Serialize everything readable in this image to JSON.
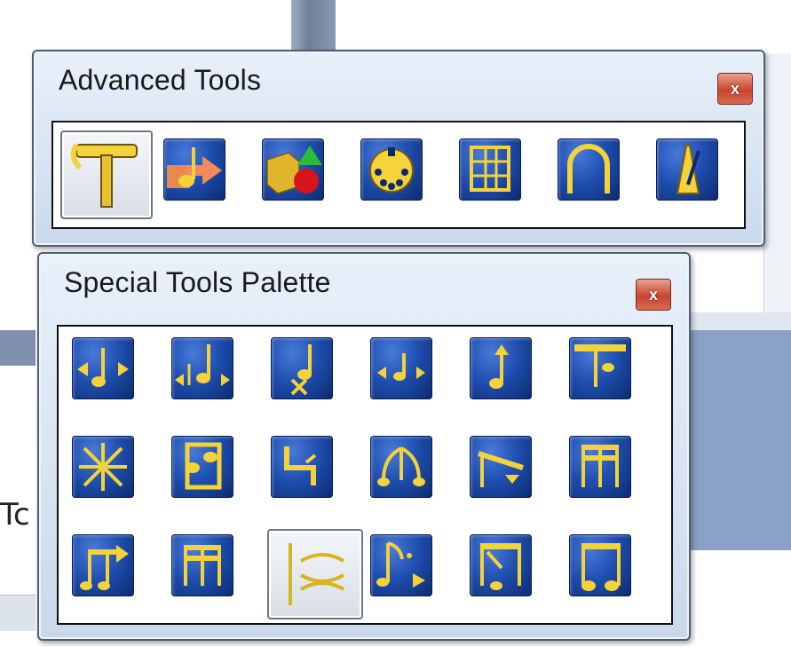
{
  "advanced_tools": {
    "title": "Advanced Tools",
    "close_label": "x",
    "tools": [
      {
        "icon": "hammer-icon",
        "selected": true
      },
      {
        "icon": "note-arrow-icon",
        "selected": false
      },
      {
        "icon": "shapes-icon",
        "selected": false
      },
      {
        "icon": "midi-plug-icon",
        "selected": false
      },
      {
        "icon": "grid-icon",
        "selected": false
      },
      {
        "icon": "arch-icon",
        "selected": false
      },
      {
        "icon": "metronome-icon",
        "selected": false
      }
    ]
  },
  "special_tools": {
    "title": "Special Tools Palette",
    "close_label": "x",
    "tools": [
      {
        "icon": "note-position-icon",
        "selected": false
      },
      {
        "icon": "accidental-mover-icon",
        "selected": false
      },
      {
        "icon": "dot-mover-icon",
        "selected": false
      },
      {
        "icon": "notehead-position-icon",
        "selected": false
      },
      {
        "icon": "stem-length-icon",
        "selected": false
      },
      {
        "icon": "stem-direction-icon",
        "selected": false
      },
      {
        "icon": "custom-stem-icon",
        "selected": false
      },
      {
        "icon": "broken-beam-icon",
        "selected": false
      },
      {
        "icon": "flag-icon",
        "selected": false
      },
      {
        "icon": "beam-angle-icon",
        "selected": false
      },
      {
        "icon": "beam-extension-icon",
        "selected": false
      },
      {
        "icon": "secondary-beam-icon",
        "selected": false
      },
      {
        "icon": "beam-width-icon",
        "selected": false
      },
      {
        "icon": "secondary-beam-break-icon",
        "selected": false
      },
      {
        "icon": "ties-icon",
        "selected": true
      },
      {
        "icon": "dots-icon",
        "selected": false
      },
      {
        "icon": "beam-angle-2-icon",
        "selected": false
      },
      {
        "icon": "beam-stem-icon",
        "selected": false
      }
    ]
  },
  "background": {
    "left_fragment": "Tc"
  },
  "colors": {
    "button_blue": "#1f4fb0",
    "glyph_yellow": "#f3d23a",
    "close_red": "#c8452f",
    "title_bar": "#d7e3f3"
  }
}
